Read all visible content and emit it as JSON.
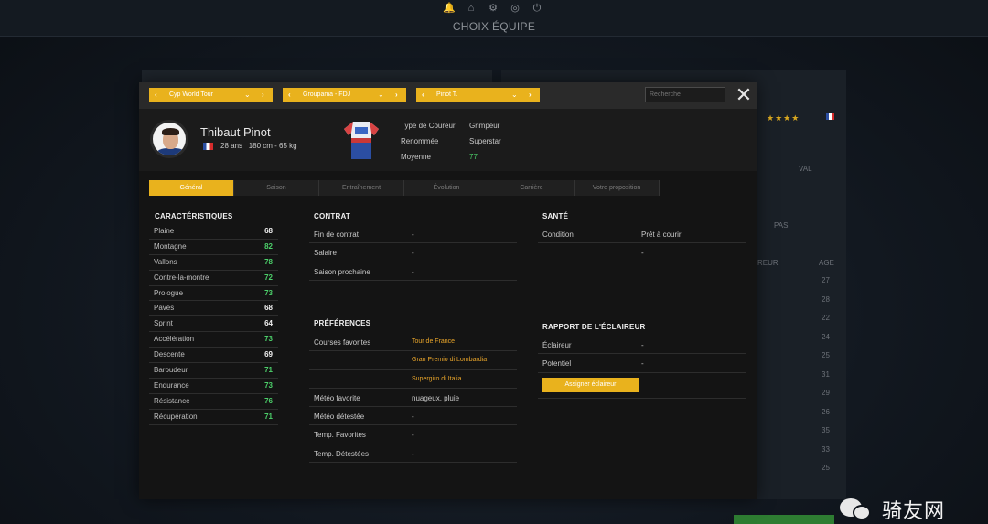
{
  "window": {
    "title": "CHOIX ÉQUIPE"
  },
  "top_icons": [
    "bell-icon",
    "home-icon",
    "settings-icon",
    "globe-icon",
    "power-icon"
  ],
  "header": {
    "selectors": [
      {
        "label": "Cyp World Tour"
      },
      {
        "label": "Groupama - FDJ"
      },
      {
        "label": "Pinot T."
      }
    ],
    "search_placeholder": "Recherche"
  },
  "profile": {
    "name": "Thibaut Pinot",
    "info": "28 ans   180 cm - 65 kg",
    "attributes": [
      {
        "label": "Type de Coureur",
        "value": "Grimpeur"
      },
      {
        "label": "Renommée",
        "value": "Superstar"
      },
      {
        "label": "Moyenne",
        "value": "77"
      }
    ]
  },
  "tabs": [
    "Général",
    "Saison",
    "Entraînement",
    "Évolution",
    "Carrière",
    "Votre proposition"
  ],
  "characteristics": {
    "title": "CARACTÉRISTIQUES",
    "items": [
      {
        "name": "Plaine",
        "value": "68"
      },
      {
        "name": "Montagne",
        "value": "82"
      },
      {
        "name": "Vallons",
        "value": "78"
      },
      {
        "name": "Contre-la-montre",
        "value": "72"
      },
      {
        "name": "Prologue",
        "value": "73"
      },
      {
        "name": "Pavés",
        "value": "68"
      },
      {
        "name": "Sprint",
        "value": "64"
      },
      {
        "name": "Accélération",
        "value": "73"
      },
      {
        "name": "Descente",
        "value": "69"
      },
      {
        "name": "Baroudeur",
        "value": "71"
      },
      {
        "name": "Endurance",
        "value": "73"
      },
      {
        "name": "Résistance",
        "value": "76"
      },
      {
        "name": "Récupération",
        "value": "71"
      }
    ]
  },
  "contract": {
    "title": "CONTRAT",
    "rows": [
      {
        "k": "Fin de contrat",
        "v": "-"
      },
      {
        "k": "Salaire",
        "v": "-"
      },
      {
        "k": "Saison prochaine",
        "v": "-"
      }
    ]
  },
  "health": {
    "title": "SANTÉ",
    "rows": [
      {
        "k": "Condition",
        "v": "Prêt à courir"
      },
      {
        "k": "",
        "v": "-"
      }
    ]
  },
  "preferences": {
    "title": "PRÉFÉRENCES",
    "rows": [
      {
        "k": "Courses favorites",
        "v": "Tour de France"
      },
      {
        "k": "",
        "v": "Gran Premio di Lombardia"
      },
      {
        "k": "",
        "v": "Supergiro di Italia"
      },
      {
        "k": "Météo favorite",
        "v": "nuageux, pluie"
      },
      {
        "k": "Météo détestée",
        "v": "-"
      },
      {
        "k": "Temp. Favorites",
        "v": "-"
      },
      {
        "k": "Temp. Détestées",
        "v": "-"
      }
    ]
  },
  "scout": {
    "title": "RAPPORT DE L'ÉCLAIREUR",
    "rows": [
      {
        "k": "Éclaireur",
        "v": "-"
      },
      {
        "k": "Potentiel",
        "v": "-"
      }
    ],
    "button": "Assigner éclaireur"
  },
  "background": {
    "stars": "★★★★",
    "labels": [
      "VAL",
      "PAS",
      "REUR",
      "AGE"
    ],
    "ages": [
      "27",
      "28",
      "22",
      "24",
      "25",
      "31",
      "29",
      "26",
      "35",
      "33",
      "25"
    ]
  },
  "watermark": {
    "text": "骑友网"
  },
  "colors": {
    "accent": "#e9b21d",
    "good": "#4cd06a"
  }
}
